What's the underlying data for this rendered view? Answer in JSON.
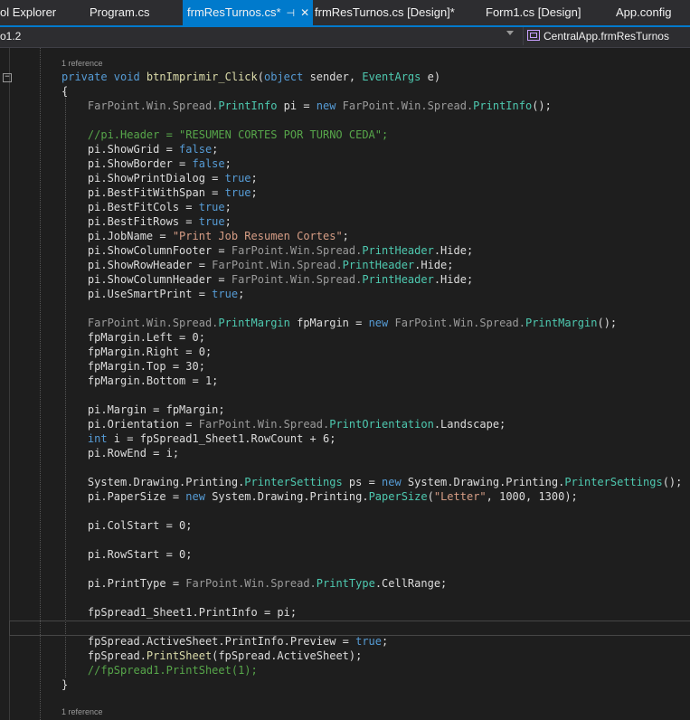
{
  "tabs": [
    {
      "label": "ol Explorer"
    },
    {
      "label": "Program.cs"
    },
    {
      "label": "frmResTurnos.cs*"
    },
    {
      "label": "frmResTurnos.cs [Design]*"
    },
    {
      "label": "Form1.cs [Design]"
    },
    {
      "label": "App.config"
    }
  ],
  "nav": {
    "left": "o1.2",
    "right": "CentralApp.frmResTurnos"
  },
  "refs": {
    "top": "1 reference",
    "bottom": "1 reference"
  },
  "code": [
    [
      [
        "kw",
        "private "
      ],
      [
        "kw",
        "void "
      ],
      [
        "mt",
        "btnImprimir_Click"
      ],
      [
        "id",
        "("
      ],
      [
        "kw",
        "object "
      ],
      [
        "id",
        "sender, "
      ],
      [
        "ty",
        "EventArgs "
      ],
      [
        "id",
        "e)"
      ]
    ],
    [
      [
        "id",
        "{"
      ]
    ],
    [
      [
        "gr",
        "    FarPoint.Win.Spread."
      ],
      [
        "ty",
        "PrintInfo "
      ],
      [
        "id",
        "pi = "
      ],
      [
        "kw",
        "new "
      ],
      [
        "gr",
        "FarPoint.Win.Spread."
      ],
      [
        "ty",
        "PrintInfo"
      ],
      [
        "id",
        "();"
      ]
    ],
    [
      [
        "id",
        ""
      ]
    ],
    [
      [
        "cm",
        "    //pi.Header = \"RESUMEN CORTES POR TURNO CEDA\";"
      ]
    ],
    [
      [
        "id",
        "    pi.ShowGrid = "
      ],
      [
        "kw",
        "false"
      ],
      [
        "id",
        ";"
      ]
    ],
    [
      [
        "id",
        "    pi.ShowBorder = "
      ],
      [
        "kw",
        "false"
      ],
      [
        "id",
        ";"
      ]
    ],
    [
      [
        "id",
        "    pi.ShowPrintDialog = "
      ],
      [
        "kw",
        "true"
      ],
      [
        "id",
        ";"
      ]
    ],
    [
      [
        "id",
        "    pi.BestFitWithSpan = "
      ],
      [
        "kw",
        "true"
      ],
      [
        "id",
        ";"
      ]
    ],
    [
      [
        "id",
        "    pi.BestFitCols = "
      ],
      [
        "kw",
        "true"
      ],
      [
        "id",
        ";"
      ]
    ],
    [
      [
        "id",
        "    pi.BestFitRows = "
      ],
      [
        "kw",
        "true"
      ],
      [
        "id",
        ";"
      ]
    ],
    [
      [
        "id",
        "    pi.JobName = "
      ],
      [
        "st",
        "\"Print Job Resumen Cortes\""
      ],
      [
        "id",
        ";"
      ]
    ],
    [
      [
        "id",
        "    pi.ShowColumnFooter = "
      ],
      [
        "gr",
        "FarPoint.Win.Spread."
      ],
      [
        "ty",
        "PrintHeader"
      ],
      [
        "id",
        ".Hide;"
      ]
    ],
    [
      [
        "id",
        "    pi.ShowRowHeader = "
      ],
      [
        "gr",
        "FarPoint.Win.Spread."
      ],
      [
        "ty",
        "PrintHeader"
      ],
      [
        "id",
        ".Hide;"
      ]
    ],
    [
      [
        "id",
        "    pi.ShowColumnHeader = "
      ],
      [
        "gr",
        "FarPoint.Win.Spread."
      ],
      [
        "ty",
        "PrintHeader"
      ],
      [
        "id",
        ".Hide;"
      ]
    ],
    [
      [
        "id",
        "    pi.UseSmartPrint = "
      ],
      [
        "kw",
        "true"
      ],
      [
        "id",
        ";"
      ]
    ],
    [
      [
        "id",
        ""
      ]
    ],
    [
      [
        "gr",
        "    FarPoint.Win.Spread."
      ],
      [
        "ty",
        "PrintMargin "
      ],
      [
        "id",
        "fpMargin = "
      ],
      [
        "kw",
        "new "
      ],
      [
        "gr",
        "FarPoint.Win.Spread."
      ],
      [
        "ty",
        "PrintMargin"
      ],
      [
        "id",
        "();"
      ]
    ],
    [
      [
        "id",
        "    fpMargin.Left = 0;"
      ]
    ],
    [
      [
        "id",
        "    fpMargin.Right = 0;"
      ]
    ],
    [
      [
        "id",
        "    fpMargin.Top = 30;"
      ]
    ],
    [
      [
        "id",
        "    fpMargin.Bottom = 1;"
      ]
    ],
    [
      [
        "id",
        ""
      ]
    ],
    [
      [
        "id",
        "    pi.Margin = fpMargin;"
      ]
    ],
    [
      [
        "id",
        "    pi.Orientation = "
      ],
      [
        "gr",
        "FarPoint.Win.Spread."
      ],
      [
        "ty",
        "PrintOrientation"
      ],
      [
        "id",
        ".Landscape;"
      ]
    ],
    [
      [
        "kw",
        "    int "
      ],
      [
        "id",
        "i = fpSpread1_Sheet1.RowCount + 6;"
      ]
    ],
    [
      [
        "id",
        "    pi.RowEnd = i;"
      ]
    ],
    [
      [
        "id",
        ""
      ]
    ],
    [
      [
        "id",
        "    System.Drawing.Printing."
      ],
      [
        "ty",
        "PrinterSettings "
      ],
      [
        "id",
        "ps = "
      ],
      [
        "kw",
        "new "
      ],
      [
        "id",
        "System.Drawing.Printing."
      ],
      [
        "ty",
        "PrinterSettings"
      ],
      [
        "id",
        "();"
      ]
    ],
    [
      [
        "id",
        "    pi.PaperSize = "
      ],
      [
        "kw",
        "new "
      ],
      [
        "id",
        "System.Drawing.Printing."
      ],
      [
        "ty",
        "PaperSize"
      ],
      [
        "id",
        "("
      ],
      [
        "st",
        "\"Letter\""
      ],
      [
        "id",
        ", 1000, 1300);"
      ]
    ],
    [
      [
        "id",
        ""
      ]
    ],
    [
      [
        "id",
        "    pi.ColStart = 0;"
      ]
    ],
    [
      [
        "id",
        ""
      ]
    ],
    [
      [
        "id",
        "    pi.RowStart = 0;"
      ]
    ],
    [
      [
        "id",
        ""
      ]
    ],
    [
      [
        "id",
        "    pi.PrintType = "
      ],
      [
        "gr",
        "FarPoint.Win.Spread."
      ],
      [
        "ty",
        "PrintType"
      ],
      [
        "id",
        ".CellRange;"
      ]
    ],
    [
      [
        "id",
        ""
      ]
    ],
    [
      [
        "id",
        "    fpSpread1_Sheet1.PrintInfo = pi;"
      ]
    ],
    [
      [
        "id",
        ""
      ]
    ],
    [
      [
        "id",
        "    fpSpread.ActiveSheet.PrintInfo.Preview = "
      ],
      [
        "kw",
        "true"
      ],
      [
        "id",
        ";"
      ]
    ],
    [
      [
        "id",
        "    fpSpread."
      ],
      [
        "mt",
        "PrintSheet"
      ],
      [
        "id",
        "(fpSpread.ActiveSheet);"
      ]
    ],
    [
      [
        "cm",
        "    //fpSpread1.PrintSheet(1);"
      ]
    ],
    [
      [
        "id",
        "}"
      ]
    ]
  ]
}
